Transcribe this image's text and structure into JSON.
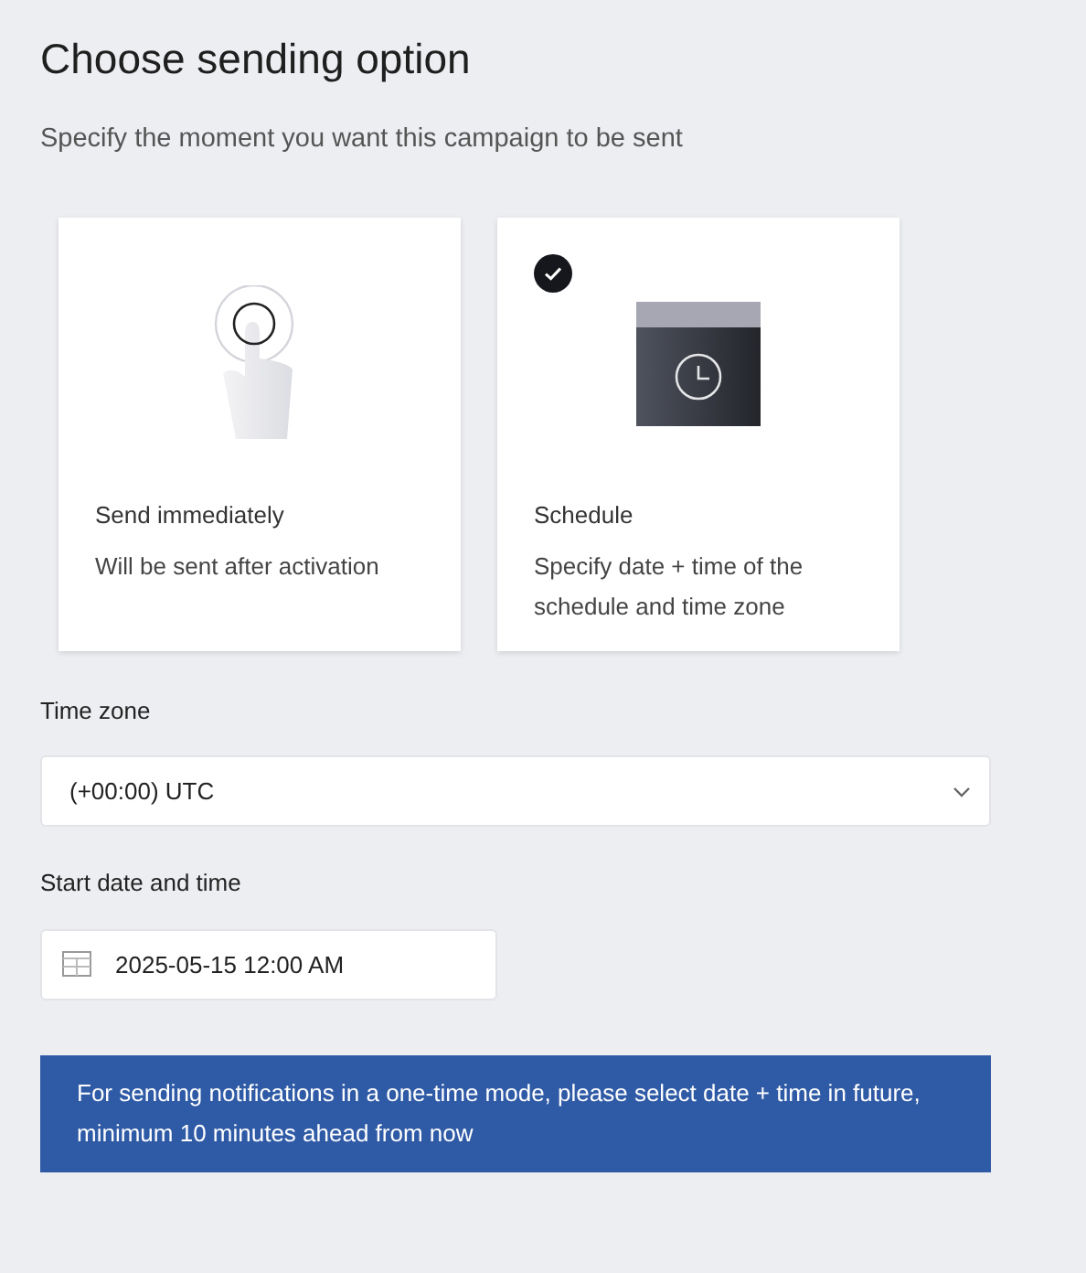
{
  "title": "Choose sending option",
  "subtitle": "Specify the moment you want this campaign to be sent",
  "options": [
    {
      "kind": "immediate",
      "title": "Send immediately",
      "description": "Will be sent after activation",
      "selected": false
    },
    {
      "kind": "schedule",
      "title": "Schedule",
      "description": "Specify date + time of the schedule and time zone",
      "selected": true
    }
  ],
  "time_zone": {
    "label": "Time zone",
    "value": "(+00:00) UTC"
  },
  "start": {
    "label": "Start date and time",
    "value": "2025-05-15 12:00 AM"
  },
  "notice": "For sending notifications in a one-time mode, please select date + time in future, minimum 10 minutes ahead from now"
}
